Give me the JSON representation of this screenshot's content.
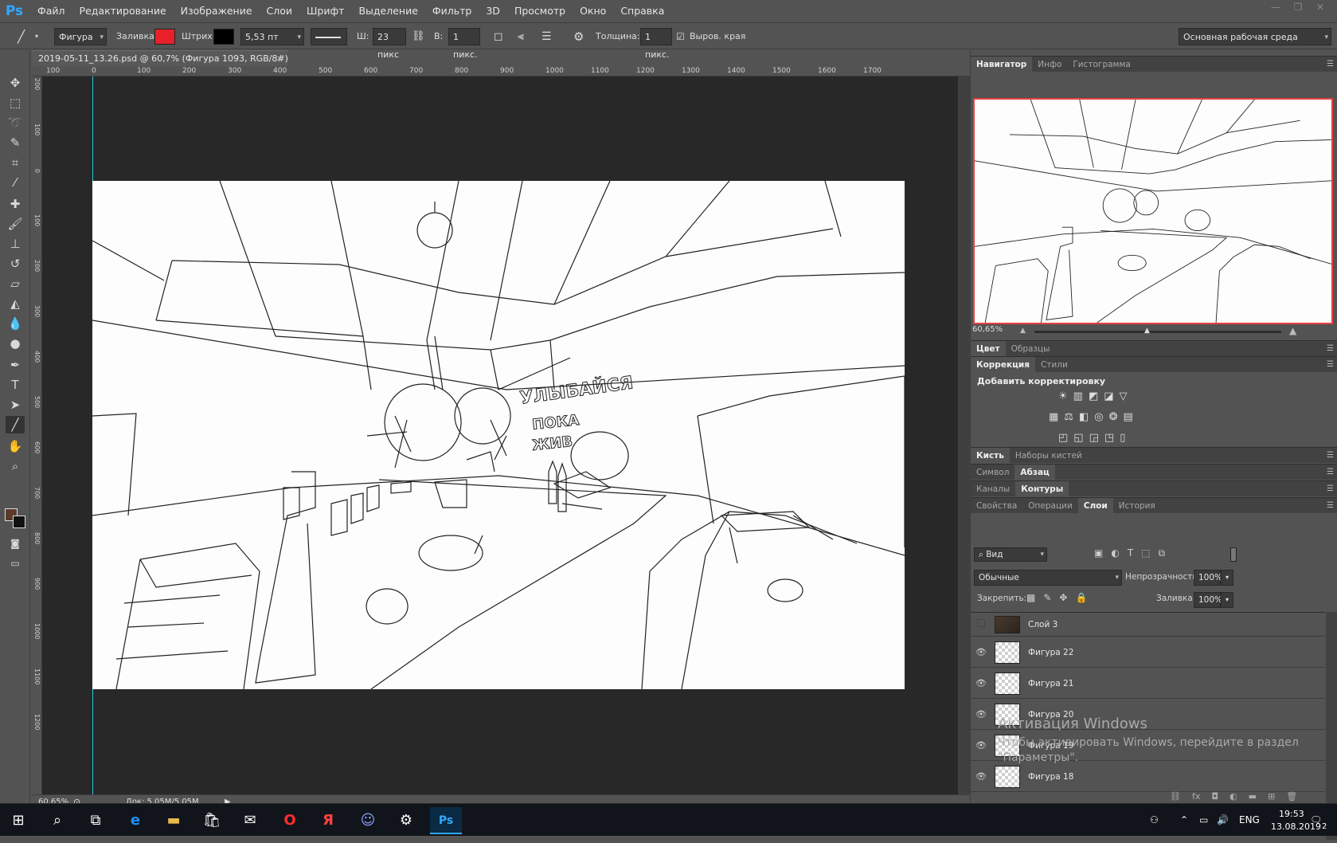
{
  "app": {
    "logo": "Ps"
  },
  "menu": [
    "Файл",
    "Редактирование",
    "Изображение",
    "Слои",
    "Шрифт",
    "Выделение",
    "Фильтр",
    "3D",
    "Просмотр",
    "Окно",
    "Справка"
  ],
  "options": {
    "shape_mode": "Фигура",
    "fill_label": "Заливка:",
    "fill_color": "#e8202a",
    "stroke_label": "Штрих:",
    "stroke_color": "#000000",
    "stroke_width": "5,53 пт",
    "w_label": "Ш:",
    "w_value": "23 пикс",
    "h_label": "В:",
    "h_value": "1 пикс.",
    "thickness_label": "Толщина:",
    "thickness_value": "1 пикс.",
    "align_edges_label": "Выров. края",
    "workspace": "Основная рабочая среда"
  },
  "document": {
    "tab_title": "2019-05-11_13.26.psd @ 60,7% (Фигура 1093, RGB/8#) *",
    "close": "×",
    "zoom": "60,65%",
    "doc_size": "Док: 5,05M/5,05M"
  },
  "ruler_top": [
    "100",
    "0",
    "100",
    "200",
    "300",
    "400",
    "500",
    "600",
    "700",
    "800",
    "900",
    "1000",
    "1100",
    "1200",
    "1300",
    "1400",
    "1500",
    "1600",
    "1700"
  ],
  "ruler_left": [
    "200",
    "100",
    "0",
    "100",
    "200",
    "300",
    "400",
    "500",
    "600",
    "700",
    "800",
    "900",
    "1000",
    "1100",
    "1200"
  ],
  "artwork": {
    "graffiti_line1": "УЛЫБАЙСЯ",
    "graffiti_line2": "ПОКА",
    "graffiti_line3": "ЖИВ"
  },
  "panels": {
    "navigator_tabs": [
      "Навигатор",
      "Инфо",
      "Гистограмма"
    ],
    "navigator_zoom": "60,65%",
    "color_tabs": [
      "Цвет",
      "Образцы"
    ],
    "adjust_tabs": [
      "Коррекция",
      "Стили"
    ],
    "adjust_title": "Добавить корректировку",
    "brush_tabs": [
      "Кисть",
      "Наборы кистей"
    ],
    "char_tabs": [
      "Символ",
      "Абзац"
    ],
    "channel_tabs": [
      "Каналы",
      "Контуры"
    ],
    "layer_tabs": [
      "Свойства",
      "Операции",
      "Слои",
      "История"
    ],
    "filter_kind": "Вид",
    "blend_mode": "Обычные",
    "opacity_label": "Непрозрачность:",
    "opacity_value": "100%",
    "lock_label": "Закрепить:",
    "fill_label": "Заливка:",
    "fill_value": "100%",
    "layers": [
      {
        "name": "Слой 3",
        "visible": false
      },
      {
        "name": "Фигура 22",
        "visible": true
      },
      {
        "name": "Фигура 21",
        "visible": true
      },
      {
        "name": "Фигура 20",
        "visible": true
      },
      {
        "name": "Фигура 19",
        "visible": true
      },
      {
        "name": "Фигура 18",
        "visible": true
      }
    ]
  },
  "watermark": {
    "title": "Активация Windows",
    "line2": "Чтобы активировать Windows, перейдите в раздел",
    "line3": "\"Параметры\"."
  },
  "taskbar": {
    "lang": "ENG",
    "time": "19:53",
    "date": "13.08.2019",
    "notif_count": "2"
  },
  "colors": {
    "accent": "#31a8ff",
    "guide": "#2ec9d9",
    "nav_frame": "#e84040"
  }
}
